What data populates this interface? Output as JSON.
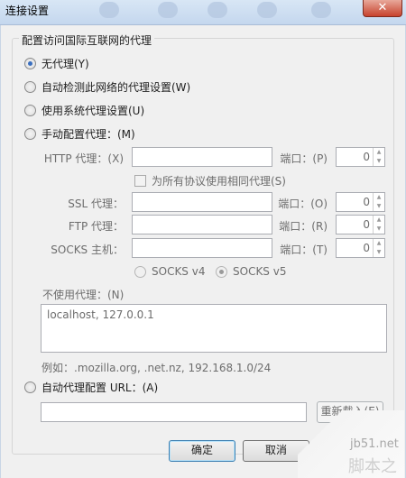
{
  "window": {
    "title": "连接设置",
    "close": "✕"
  },
  "group_title": "配置访问国际互联网的代理",
  "options": {
    "no_proxy": "无代理(Y)",
    "auto_detect": "自动检测此网络的代理设置(W)",
    "system_proxy": "使用系统代理设置(U)",
    "manual": "手动配置代理：(M)",
    "auto_url": "自动代理配置 URL：(A)"
  },
  "manual": {
    "http_label": "HTTP 代理：(X)",
    "port_label_p": "端口：(P)",
    "http_port": "0",
    "same_proxy": "为所有协议使用相同代理(S)",
    "ssl_label": "SSL 代理：",
    "port_label_o": "端口：(O)",
    "ssl_port": "0",
    "ftp_label": "FTP 代理：",
    "port_label_r": "端口：(R)",
    "ftp_port": "0",
    "socks_label": "SOCKS 主机：",
    "port_label_t": "端口：(T)",
    "socks_port": "0",
    "socks_v4": "SOCKS v4",
    "socks_v5": "SOCKS v5"
  },
  "no_proxy_for": {
    "label": "不使用代理：(N)",
    "value": "localhost, 127.0.0.1",
    "example": "例如：.mozilla.org, .net.nz, 192.168.1.0/24"
  },
  "buttons": {
    "reload": "重新载入(E)",
    "ok": "确定",
    "cancel": "取消"
  },
  "watermark": {
    "site": "jb51.net",
    "brand": "脚本之家"
  }
}
